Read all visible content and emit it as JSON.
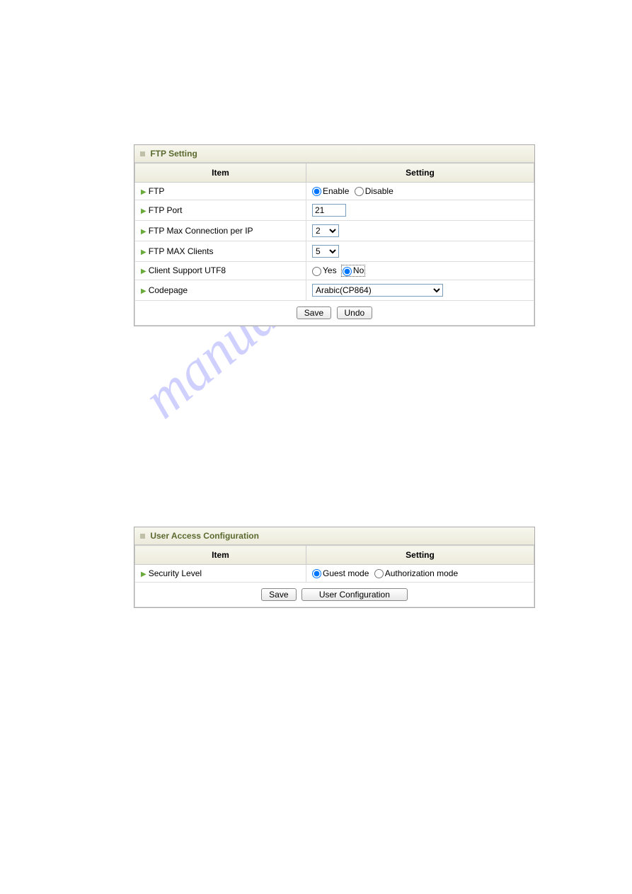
{
  "watermark": "manualshive.com",
  "panel1": {
    "title": "FTP Setting",
    "header_item": "Item",
    "header_setting": "Setting",
    "rows": {
      "ftp": {
        "label": "FTP",
        "enable": "Enable",
        "disable": "Disable"
      },
      "port": {
        "label": "FTP Port",
        "value": "21"
      },
      "maxconn": {
        "label": "FTP Max Connection per IP",
        "value": "2"
      },
      "maxclients": {
        "label": "FTP MAX Clients",
        "value": "5"
      },
      "utf8": {
        "label": "Client Support UTF8",
        "yes": "Yes",
        "no": "No"
      },
      "codepage": {
        "label": "Codepage",
        "value": "Arabic(CP864)"
      }
    },
    "save": "Save",
    "undo": "Undo"
  },
  "panel2": {
    "title": "User Access Configuration",
    "header_item": "Item",
    "header_setting": "Setting",
    "rows": {
      "security": {
        "label": "Security Level",
        "guest": "Guest mode",
        "auth": "Authorization mode"
      }
    },
    "save": "Save",
    "userconf": "User Configuration"
  }
}
